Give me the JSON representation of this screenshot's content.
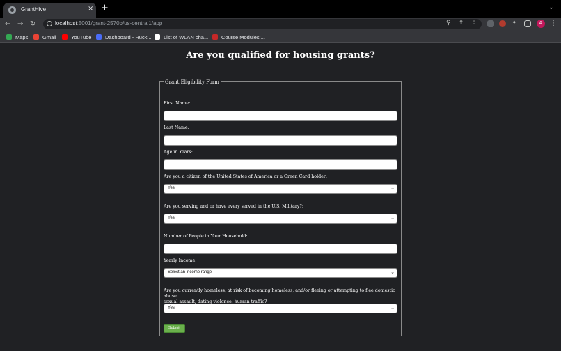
{
  "browser": {
    "tab_title": "GrantHive",
    "tab_close": "×",
    "new_tab": "+",
    "url_host": "localhost",
    "url_path": ":5001/grant-2570b/us-central1/app",
    "profile_initial": "A",
    "icons": [
      "back-arrow-icon",
      "forward-arrow-icon",
      "reload-icon",
      "site-info-icon",
      "zoom-icon",
      "share-icon",
      "star-icon",
      "extension-icon",
      "side-panel-icon",
      "kebab-menu-icon"
    ]
  },
  "bookmarks": [
    {
      "label": "Maps",
      "color": "#34a853"
    },
    {
      "label": "Gmail",
      "color": "#ea4335"
    },
    {
      "label": "YouTube",
      "color": "#ff0000"
    },
    {
      "label": "Dashboard - Ruck...",
      "color": "#4a6cf7"
    },
    {
      "label": "List of WLAN cha...",
      "color": "#ffffff"
    },
    {
      "label": "Course Modules:...",
      "color": "#c62828"
    }
  ],
  "page": {
    "title": "Are you qualified for housing grants?"
  },
  "form": {
    "legend": "Grant Eligibility Form",
    "first_name_label": "First Name:",
    "last_name_label": "Last Name:",
    "age_label": "Age in Years:",
    "citizen_label": "Are you a citizen of the United States of America or a Green Card holder:",
    "citizen_value": "Yes",
    "military_label": "Are you serving and or have every served in the U.S. Military?:",
    "military_value": "Yes",
    "household_label": "Number of People in Your Household:",
    "income_label": "Yearly Income:",
    "income_value": "Select an income range",
    "homeless_label_line1": "Are you currently homeless, at risk of becoming homeless, and/or fleeing or attempting to flee domestic abuse,",
    "homeless_label_line2": "sexual assault, dating violence, human traffic?",
    "homeless_value": "Yes",
    "submit_label": "Submit"
  },
  "colors": {
    "page_bg": "#202124",
    "submit_bg": "#6ab04c"
  }
}
